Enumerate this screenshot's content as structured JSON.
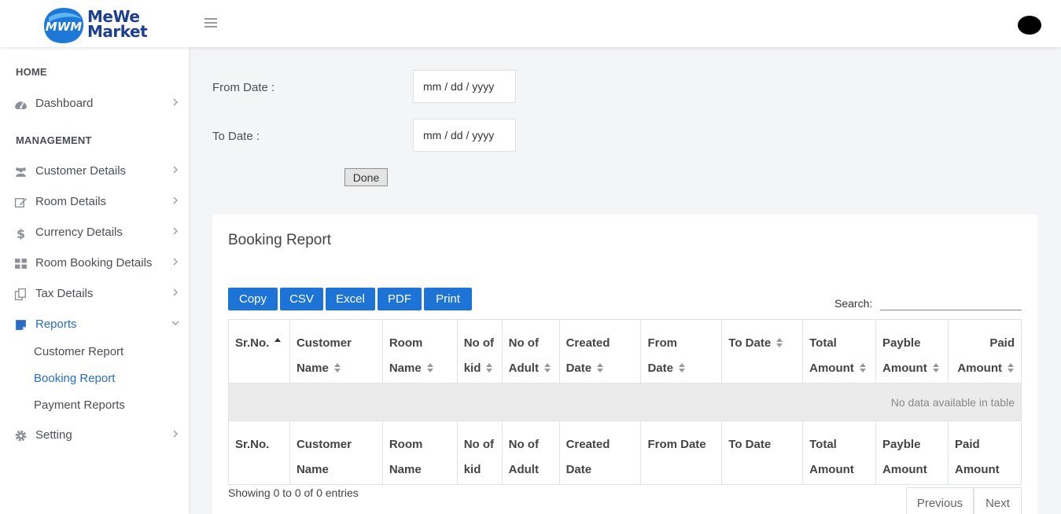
{
  "header": {
    "logo_line1": "MeWe",
    "logo_line2": "Market",
    "logo_badge_text": "MWM"
  },
  "sidebar": {
    "sections": [
      "HOME",
      "MANAGEMENT"
    ],
    "items": [
      {
        "label": "Dashboard",
        "icon": "dashboard-icon"
      },
      {
        "label": "Customer Details",
        "icon": "users-icon"
      },
      {
        "label": "Room Details",
        "icon": "edit-icon"
      },
      {
        "label": "Currency Details",
        "icon": "dollar-icon"
      },
      {
        "label": "Room Booking Details",
        "icon": "grid-icon"
      },
      {
        "label": "Tax Details",
        "icon": "copy-icon"
      },
      {
        "label": "Reports",
        "icon": "report-icon"
      },
      {
        "label": "Setting",
        "icon": "gear-icon"
      }
    ],
    "sub_items": [
      "Customer Report",
      "Booking Report",
      "Payment Reports"
    ],
    "active_item": "Reports",
    "active_sub_item": "Booking Report"
  },
  "filters": {
    "from_label": "From Date :",
    "to_label": "To Date :",
    "from_value": "mm / dd / yyyy",
    "to_value": "mm / dd / yyyy",
    "done_label": "Done"
  },
  "report": {
    "title": "Booking Report",
    "buttons": [
      "Copy",
      "CSV",
      "Excel",
      "PDF",
      "Print"
    ],
    "search_label": "Search:",
    "head_columns": [
      [
        "Sr.No."
      ],
      [
        "Customer",
        "Name"
      ],
      [
        "Room",
        "Name"
      ],
      [
        "No of",
        "kid"
      ],
      [
        "No of",
        "Adult"
      ],
      [
        "Created",
        "Date"
      ],
      [
        "From",
        "Date"
      ],
      [
        "To Date"
      ],
      [
        "Total",
        "Amount"
      ],
      [
        "Payble",
        "Amount"
      ],
      [
        "Paid",
        "Amount"
      ]
    ],
    "foot_columns": [
      [
        "Sr.No."
      ],
      [
        "Customer",
        "Name"
      ],
      [
        "Room",
        "Name"
      ],
      [
        "No of",
        "kid"
      ],
      [
        "No of",
        "Adult"
      ],
      [
        "Created",
        "Date"
      ],
      [
        "From Date"
      ],
      [
        "To Date"
      ],
      [
        "Total",
        "Amount"
      ],
      [
        "Payble",
        "Amount"
      ],
      [
        "Paid",
        "Amount"
      ]
    ],
    "empty_message": "No data available in table",
    "info": "Showing 0 to 0 of 0 entries",
    "prev_label": "Previous",
    "next_label": "Next"
  },
  "colors": {
    "accent": "#1e74d6",
    "active_text": "#2a6cc4"
  }
}
